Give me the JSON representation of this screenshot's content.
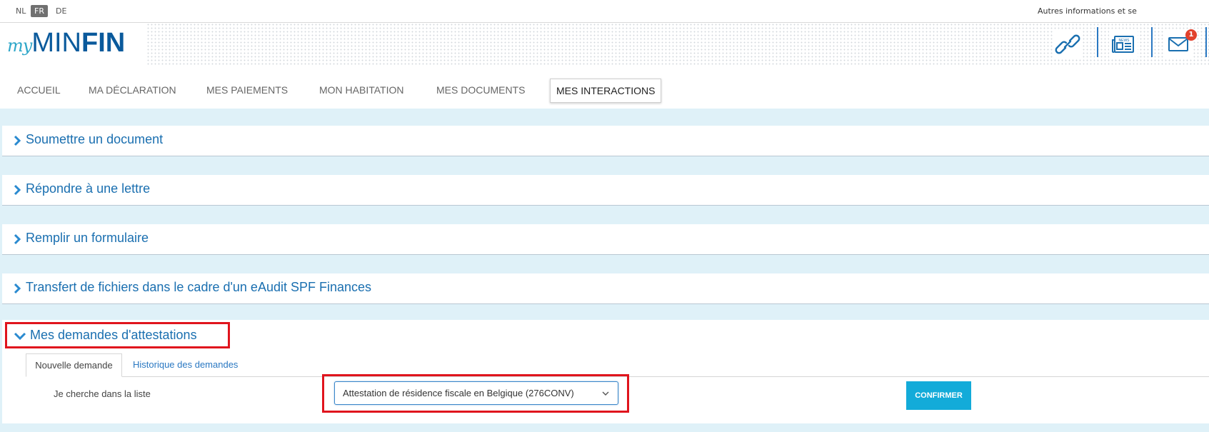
{
  "languages": [
    {
      "code": "NL",
      "active": false
    },
    {
      "code": "FR",
      "active": true
    },
    {
      "code": "DE",
      "active": false
    }
  ],
  "topbar": {
    "autres": "Autres informations et se"
  },
  "logo": {
    "my": "my",
    "min": "MIN",
    "fin": "FIN"
  },
  "header_icons": {
    "links": "link-icon",
    "news": "news-icon",
    "mail": "mail-icon",
    "mail_badge": "1"
  },
  "nav": {
    "items": [
      "ACCUEIL",
      "MA DÉCLARATION",
      "MES PAIEMENTS",
      "MON HABITATION",
      "MES DOCUMENTS",
      "MES INTERACTIONS"
    ],
    "active": "MES INTERACTIONS"
  },
  "panels": [
    {
      "title": "Soumettre un document",
      "expanded": false
    },
    {
      "title": "Répondre à une lettre",
      "expanded": false
    },
    {
      "title": "Remplir un formulaire",
      "expanded": false
    },
    {
      "title": "Transfert de fichiers dans le cadre d'un eAudit SPF Finances",
      "expanded": false
    },
    {
      "title": "Mes demandes d'attestations",
      "expanded": true
    }
  ],
  "attestations": {
    "tabs": [
      "Nouvelle demande",
      "Historique des demandes"
    ],
    "field_label": "Je cherche dans la liste",
    "selected": "Attestation de résidence fiscale en Belgique (276CONV)",
    "confirm_label": "CONFIRMER"
  },
  "colors": {
    "accent": "#1a6fb0",
    "highlight": "#e0141d",
    "button": "#13abd9",
    "background": "#dff1f8"
  }
}
